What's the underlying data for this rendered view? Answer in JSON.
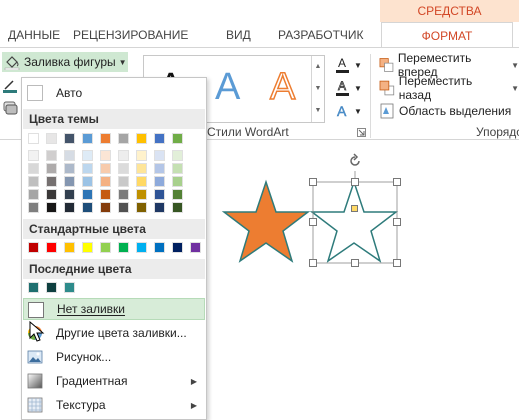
{
  "ribbon": {
    "context_group": "СРЕДСТВА РИСОВАНИЯ",
    "tabs": [
      "ДАННЫЕ",
      "РЕЦЕНЗИРОВАНИЕ",
      "ВИД",
      "РАЗРАБОТЧИК"
    ],
    "active_tab": "ФОРМАТ",
    "fill_button": "Заливка фигуры",
    "wordart_group_label": "Стили WordArt",
    "wordart_letter": "A",
    "arrange_group_label": "Упорядо",
    "arrange": [
      "Переместить вперед",
      "Переместить назад",
      "Область выделения"
    ]
  },
  "menu": {
    "auto": "Авто",
    "theme_colors_header": "Цвета темы",
    "theme_colors": [
      [
        "#ffffff",
        "#e7e6e6",
        "#44546a",
        "#5b9bd5",
        "#ed7d31",
        "#a5a5a5",
        "#ffc000",
        "#4472c4",
        "#70ad47"
      ],
      [
        "#f2f2f2",
        "#d0cece",
        "#d6dce4",
        "#deebf6",
        "#fbe5d5",
        "#ededed",
        "#fff2cc",
        "#dae3f3",
        "#e2efd9"
      ],
      [
        "#d8d8d8",
        "#aeabab",
        "#adb9ca",
        "#bdd7ee",
        "#f7cbac",
        "#dbdbdb",
        "#fee599",
        "#b4c6e7",
        "#c5e0b3"
      ],
      [
        "#bfbfbf",
        "#757070",
        "#8496b0",
        "#9cc3e5",
        "#f4b183",
        "#c9c9c9",
        "#ffd965",
        "#8eaadb",
        "#a8d08d"
      ],
      [
        "#a5a5a5",
        "#3a3838",
        "#323f4f",
        "#2e75b5",
        "#c55a11",
        "#7b7b7b",
        "#bf9000",
        "#2f5496",
        "#538135"
      ],
      [
        "#7f7f7f",
        "#171616",
        "#222a35",
        "#1e4e79",
        "#843c0b",
        "#525252",
        "#7f6000",
        "#1f3864",
        "#375623"
      ]
    ],
    "standard_colors_header": "Стандартные цвета",
    "standard_colors": [
      "#c00000",
      "#ff0000",
      "#ffc000",
      "#ffff00",
      "#92d050",
      "#00b050",
      "#00b0f0",
      "#0070c0",
      "#002060",
      "#7030a0"
    ],
    "recent_colors_header": "Последние цвета",
    "recent_colors": [
      "#1f6f6f",
      "#0f4040",
      "#2e8b8b"
    ],
    "no_fill": "Нет заливки",
    "more_colors": "Другие цвета заливки...",
    "picture": "Рисунок...",
    "gradient": "Градиентная",
    "texture": "Текстура"
  },
  "shapes": {
    "orange_star_color": "#ed7d31",
    "outline_star_color": "#2e7b7b"
  }
}
